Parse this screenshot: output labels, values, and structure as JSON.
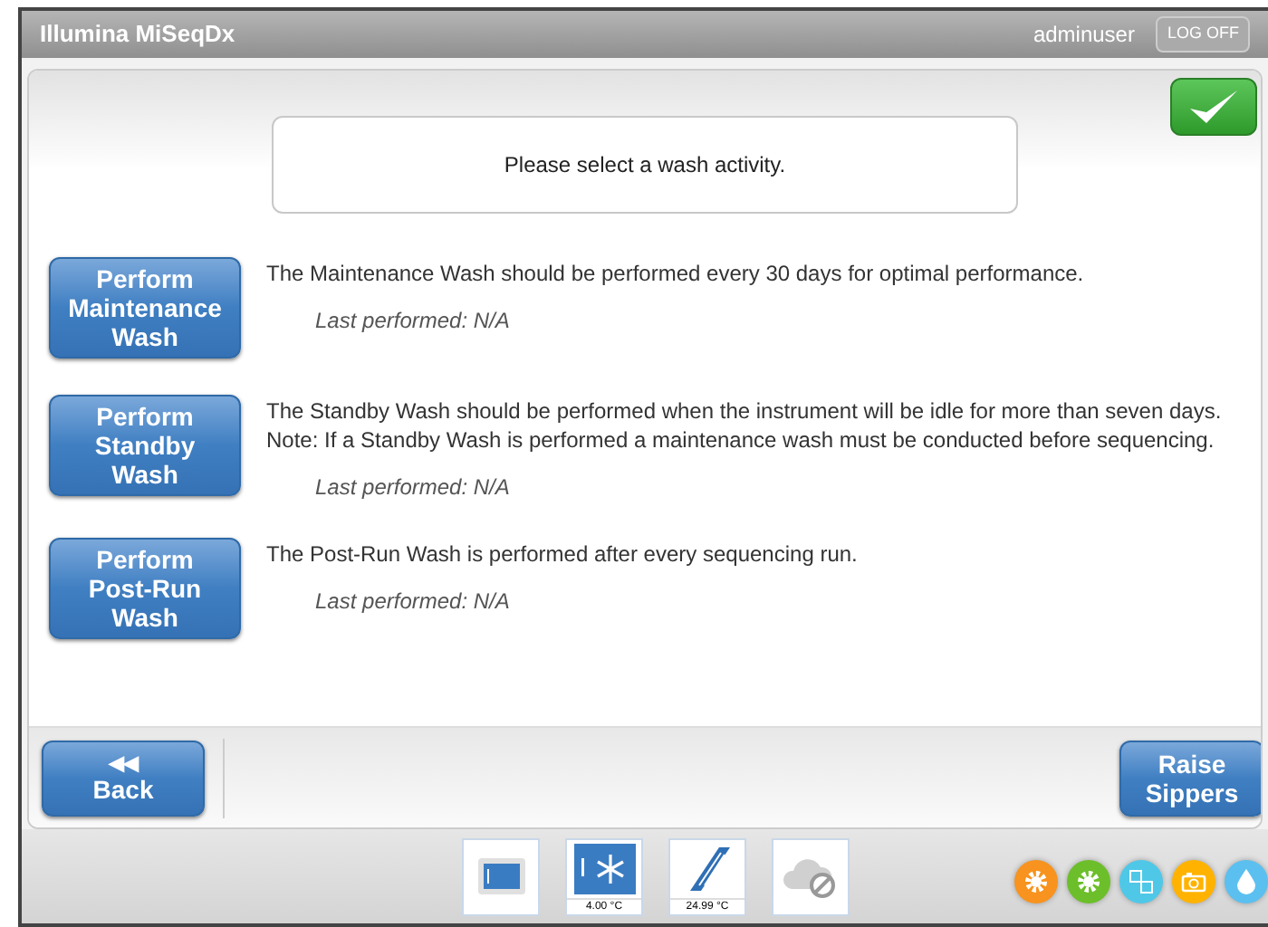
{
  "header": {
    "title": "Illumina MiSeqDx",
    "user": "adminuser",
    "logoff": "LOG OFF"
  },
  "prompt": "Please select a wash activity.",
  "washes": [
    {
      "button": [
        "Perform",
        "Maintenance",
        "Wash"
      ],
      "description": [
        "The Maintenance Wash should be performed every 30 days for optimal performance."
      ],
      "last": "Last performed: N/A"
    },
    {
      "button": [
        "Perform",
        "Standby",
        "Wash"
      ],
      "description": [
        "The Standby Wash should be performed when the instrument will be idle for more than seven days.",
        "Note: If a Standby Wash is performed a maintenance wash must be conducted before sequencing."
      ],
      "last": "Last performed: N/A"
    },
    {
      "button": [
        "Perform",
        "Post-Run",
        "Wash"
      ],
      "description": [
        "The Post-Run Wash is performed after every sequencing run."
      ],
      "last": "Last performed: N/A"
    }
  ],
  "footer": {
    "back": "Back",
    "back_icon": "◀◀",
    "raise": [
      "Raise",
      "Sippers"
    ]
  },
  "consumables": [
    {
      "kind": "flowcell"
    },
    {
      "kind": "reagent",
      "reading": "4.00 °C"
    },
    {
      "kind": "buffer",
      "reading": "24.99 °C"
    },
    {
      "kind": "network"
    }
  ],
  "indicators": [
    {
      "kind": "gear",
      "color": "#f7931e"
    },
    {
      "kind": "gear",
      "color": "#6cbf2a"
    },
    {
      "kind": "grid",
      "color": "#4fc8e8"
    },
    {
      "kind": "camera",
      "color": "#ffb300"
    },
    {
      "kind": "drop",
      "color": "#5bc0f0"
    }
  ]
}
